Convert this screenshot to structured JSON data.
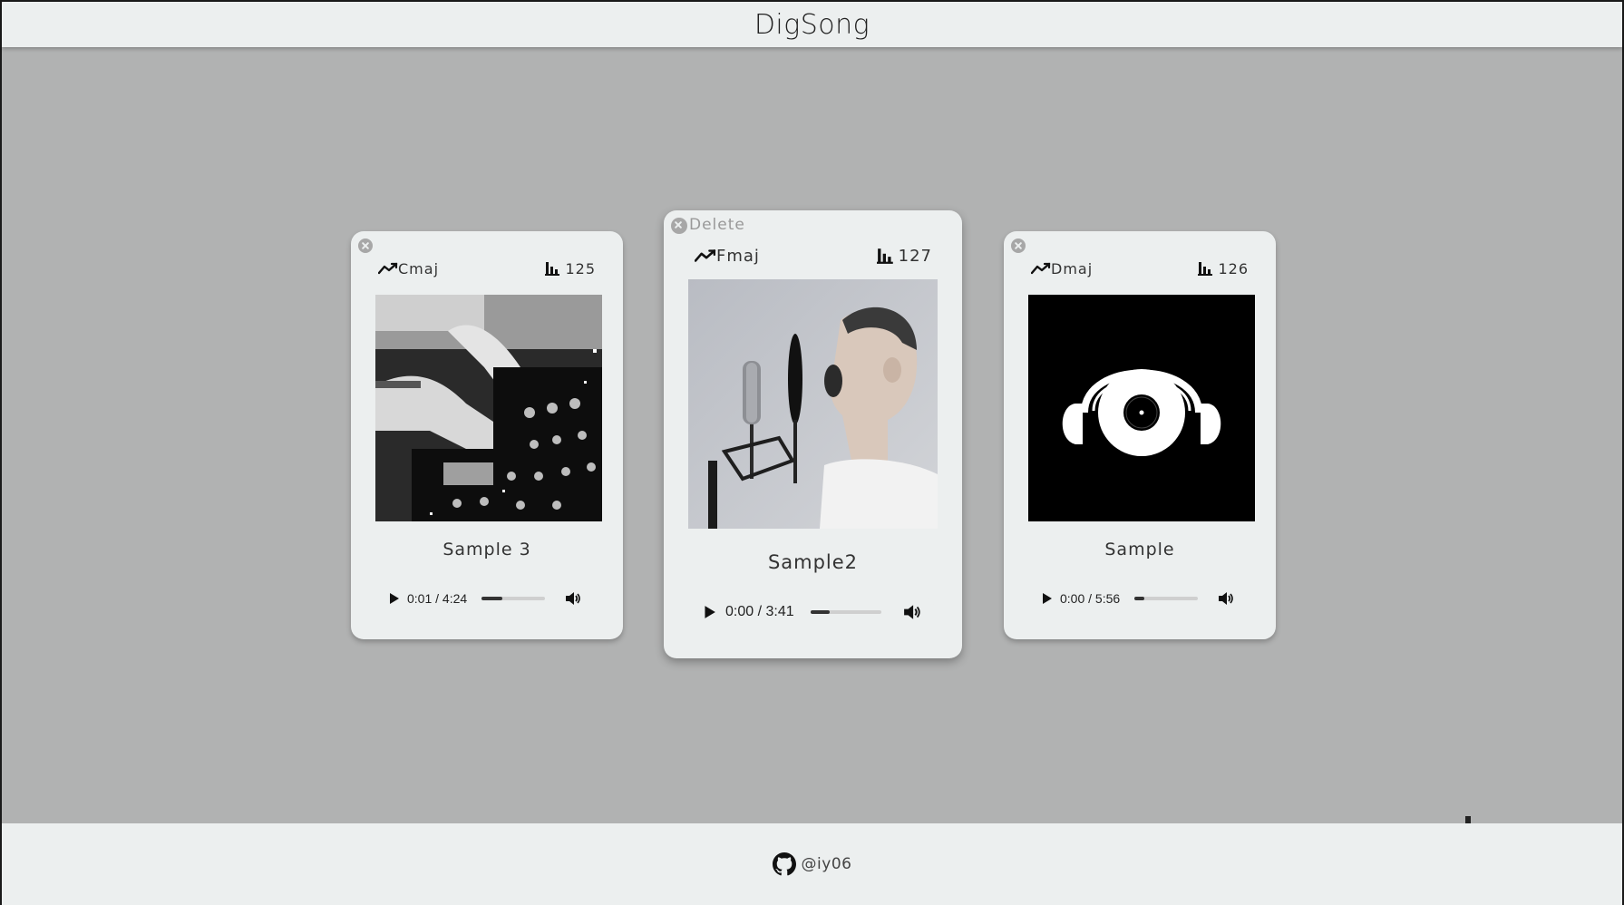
{
  "app": {
    "title": "DigSong"
  },
  "footer": {
    "handle": "@iy06",
    "icon": "github-icon"
  },
  "cards": [
    {
      "key": "Cmaj",
      "bpm": "125",
      "title": "Sample 3",
      "time": "0:01 / 4:24",
      "progress": 0.32,
      "cover": "dj-mixer-photo"
    },
    {
      "key": "Fmaj",
      "bpm": "127",
      "title": "Sample2",
      "time": "0:00 / 3:41",
      "progress": 0.28,
      "cover": "boy-singing-microphone-photo",
      "delete_label": "Delete"
    },
    {
      "key": "Dmaj",
      "bpm": "126",
      "title": "Sample",
      "time": "0:00 / 5:56",
      "progress": 0.15,
      "cover": "headphones-vinyl-logo"
    }
  ],
  "icons": {
    "close": "close-circle-icon",
    "key": "key-trend-icon",
    "bpm": "bar-chart-icon",
    "play": "play-icon",
    "volume": "volume-icon",
    "add": "plus-icon"
  },
  "colors": {
    "background": "#b1b2b2",
    "surface": "#ecefef",
    "text": "#333333"
  }
}
